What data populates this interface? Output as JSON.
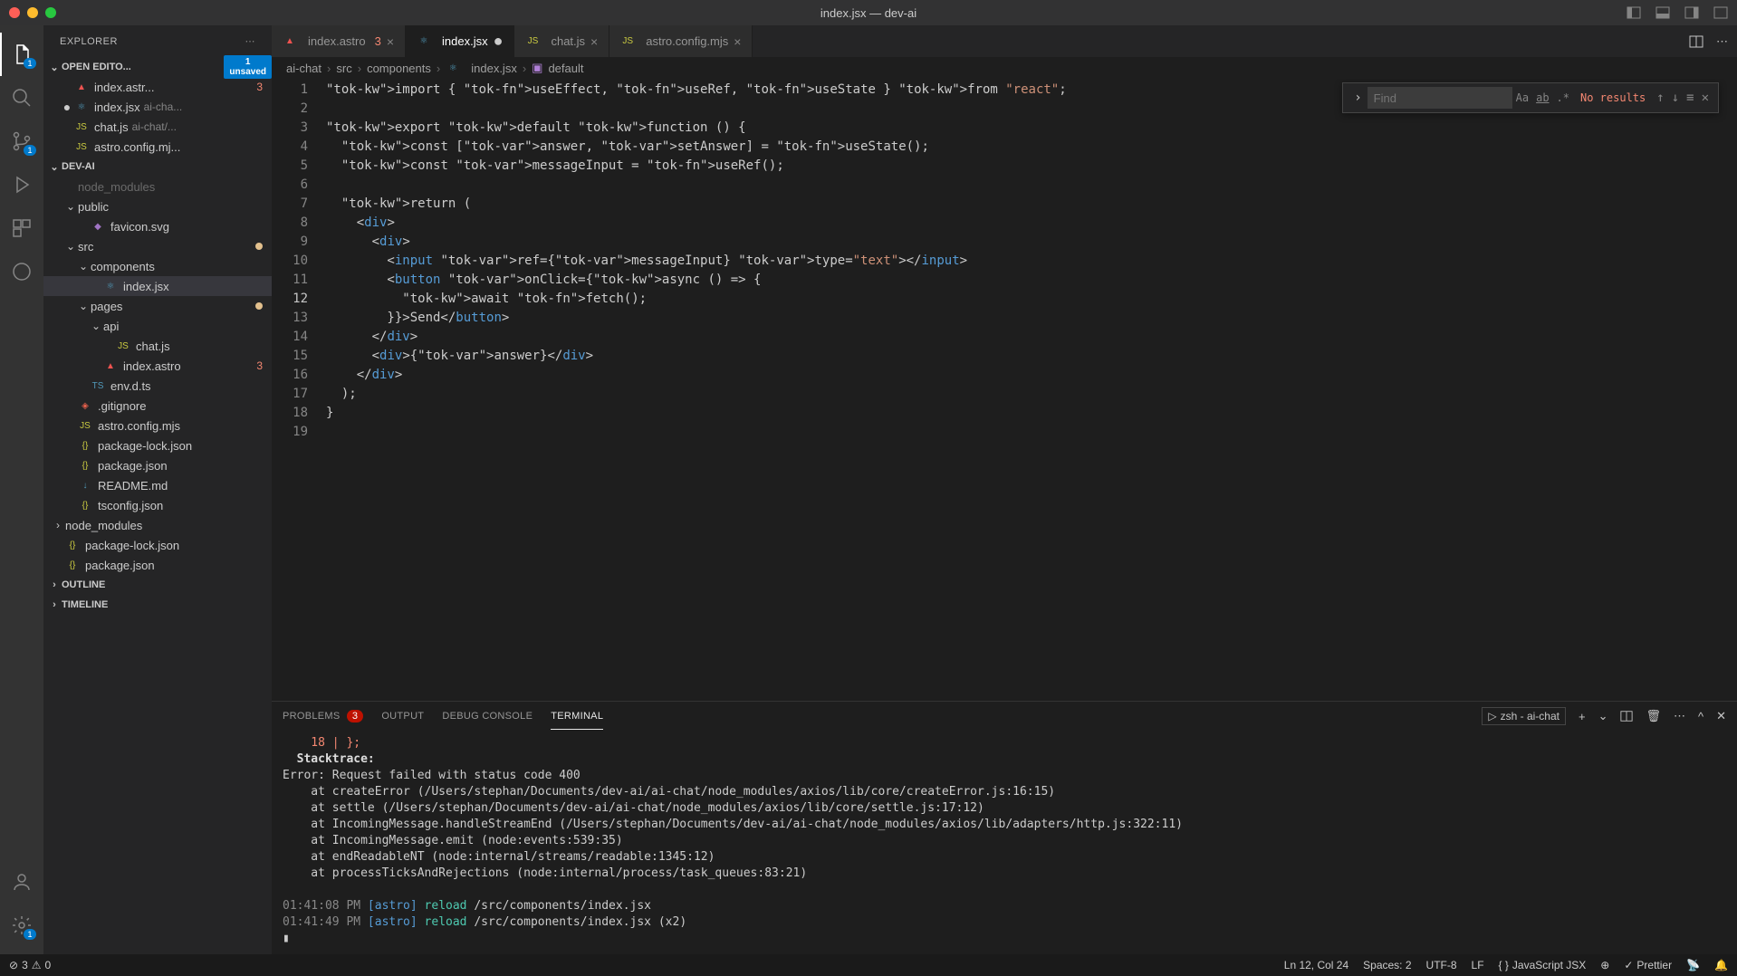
{
  "window": {
    "title": "index.jsx — dev-ai"
  },
  "explorer": {
    "title": "EXPLORER",
    "openEditors": {
      "label": "OPEN EDITO...",
      "unsavedCount": "1",
      "unsavedLabel": "unsaved",
      "items": [
        {
          "name": "index.astr...",
          "icon": "astro",
          "problems": "3"
        },
        {
          "name": "index.jsx",
          "icon": "react",
          "suffix": "ai-cha...",
          "dirty": true
        },
        {
          "name": "chat.js",
          "icon": "js",
          "suffix": "ai-chat/..."
        },
        {
          "name": "astro.config.mj...",
          "icon": "js"
        }
      ]
    },
    "workspace": {
      "label": "DEV-AI",
      "tree": [
        {
          "depth": 1,
          "chev": "",
          "name": "node_modules",
          "icon": "",
          "dim": true
        },
        {
          "depth": 1,
          "chev": "⌄",
          "name": "public",
          "icon": ""
        },
        {
          "depth": 2,
          "chev": "",
          "name": "favicon.svg",
          "icon": "svg"
        },
        {
          "depth": 1,
          "chev": "⌄",
          "name": "src",
          "icon": "",
          "modified": true
        },
        {
          "depth": 2,
          "chev": "⌄",
          "name": "components",
          "icon": ""
        },
        {
          "depth": 3,
          "chev": "",
          "name": "index.jsx",
          "icon": "react",
          "selected": true
        },
        {
          "depth": 2,
          "chev": "⌄",
          "name": "pages",
          "icon": "",
          "modified": true
        },
        {
          "depth": 3,
          "chev": "⌄",
          "name": "api",
          "icon": ""
        },
        {
          "depth": 4,
          "chev": "",
          "name": "chat.js",
          "icon": "js"
        },
        {
          "depth": 3,
          "chev": "",
          "name": "index.astro",
          "icon": "astro",
          "problems": "3"
        },
        {
          "depth": 2,
          "chev": "",
          "name": "env.d.ts",
          "icon": "ts"
        },
        {
          "depth": 1,
          "chev": "",
          "name": ".gitignore",
          "icon": "git"
        },
        {
          "depth": 1,
          "chev": "",
          "name": "astro.config.mjs",
          "icon": "js"
        },
        {
          "depth": 1,
          "chev": "",
          "name": "package-lock.json",
          "icon": "json"
        },
        {
          "depth": 1,
          "chev": "",
          "name": "package.json",
          "icon": "json"
        },
        {
          "depth": 1,
          "chev": "",
          "name": "README.md",
          "icon": "md"
        },
        {
          "depth": 1,
          "chev": "",
          "name": "tsconfig.json",
          "icon": "json"
        },
        {
          "depth": 0,
          "chev": "›",
          "name": "node_modules",
          "icon": ""
        },
        {
          "depth": 0,
          "chev": "",
          "name": "package-lock.json",
          "icon": "json"
        },
        {
          "depth": 0,
          "chev": "",
          "name": "package.json",
          "icon": "json"
        }
      ]
    },
    "outline": "OUTLINE",
    "timeline": "TIMELINE"
  },
  "tabs": [
    {
      "name": "index.astro",
      "icon": "astro",
      "problems": "3"
    },
    {
      "name": "index.jsx",
      "icon": "react",
      "active": true,
      "dirty": true
    },
    {
      "name": "chat.js",
      "icon": "js"
    },
    {
      "name": "astro.config.mjs",
      "icon": "js"
    }
  ],
  "breadcrumbs": [
    "ai-chat",
    "src",
    "components",
    "index.jsx",
    "default"
  ],
  "find": {
    "placeholder": "Find",
    "matchCase": "Aa",
    "wholeWord": "ab",
    "regex": ".*",
    "results": "No results"
  },
  "code": {
    "lines": [
      "import { useEffect, useRef, useState } from \"react\";",
      "",
      "export default function () {",
      "  const [answer, setAnswer] = useState();",
      "  const messageInput = useRef();",
      "",
      "  return (",
      "    <div>",
      "      <div>",
      "        <input ref={messageInput} type=\"text\"></input>",
      "        <button onClick={async () => {",
      "          await fetch();",
      "        }}>Send</button>",
      "      </div>",
      "      <div>{answer}</div>",
      "    </div>",
      "  );",
      "}",
      ""
    ],
    "activeLine": 12
  },
  "panel": {
    "tabs": {
      "problems": "PROBLEMS",
      "problemsCount": "3",
      "output": "OUTPUT",
      "debug": "DEBUG CONSOLE",
      "terminal": "TERMINAL"
    },
    "terminalSelect": "zsh - ai-chat",
    "terminal": [
      {
        "cls": "t-err",
        "text": "    18 | };"
      },
      {
        "cls": "t-bold",
        "text": "  Stacktrace:"
      },
      {
        "cls": "",
        "text": "Error: Request failed with status code 400"
      },
      {
        "cls": "",
        "text": "    at createError (/Users/stephan/Documents/dev-ai/ai-chat/node_modules/axios/lib/core/createError.js:16:15)"
      },
      {
        "cls": "",
        "text": "    at settle (/Users/stephan/Documents/dev-ai/ai-chat/node_modules/axios/lib/core/settle.js:17:12)"
      },
      {
        "cls": "",
        "text": "    at IncomingMessage.handleStreamEnd (/Users/stephan/Documents/dev-ai/ai-chat/node_modules/axios/lib/adapters/http.js:322:11)"
      },
      {
        "cls": "",
        "text": "    at IncomingMessage.emit (node:events:539:35)"
      },
      {
        "cls": "",
        "text": "    at endReadableNT (node:internal/streams/readable:1345:12)"
      },
      {
        "cls": "",
        "text": "    at processTicksAndRejections (node:internal/process/task_queues:83:21)"
      },
      {
        "cls": "",
        "text": ""
      },
      {
        "cls": "reload",
        "text": "01:41:08 PM [astro] reload /src/components/index.jsx"
      },
      {
        "cls": "reload",
        "text": "01:41:49 PM [astro] reload /src/components/index.jsx (x2)"
      },
      {
        "cls": "",
        "text": "▮"
      }
    ]
  },
  "status": {
    "errors": "3",
    "warnings": "0",
    "lineCol": "Ln 12, Col 24",
    "spaces": "Spaces: 2",
    "encoding": "UTF-8",
    "eol": "LF",
    "language": "JavaScript JSX",
    "prettier": "Prettier"
  },
  "activity": {
    "explorerBadge": "1",
    "scmBadge": "1"
  }
}
